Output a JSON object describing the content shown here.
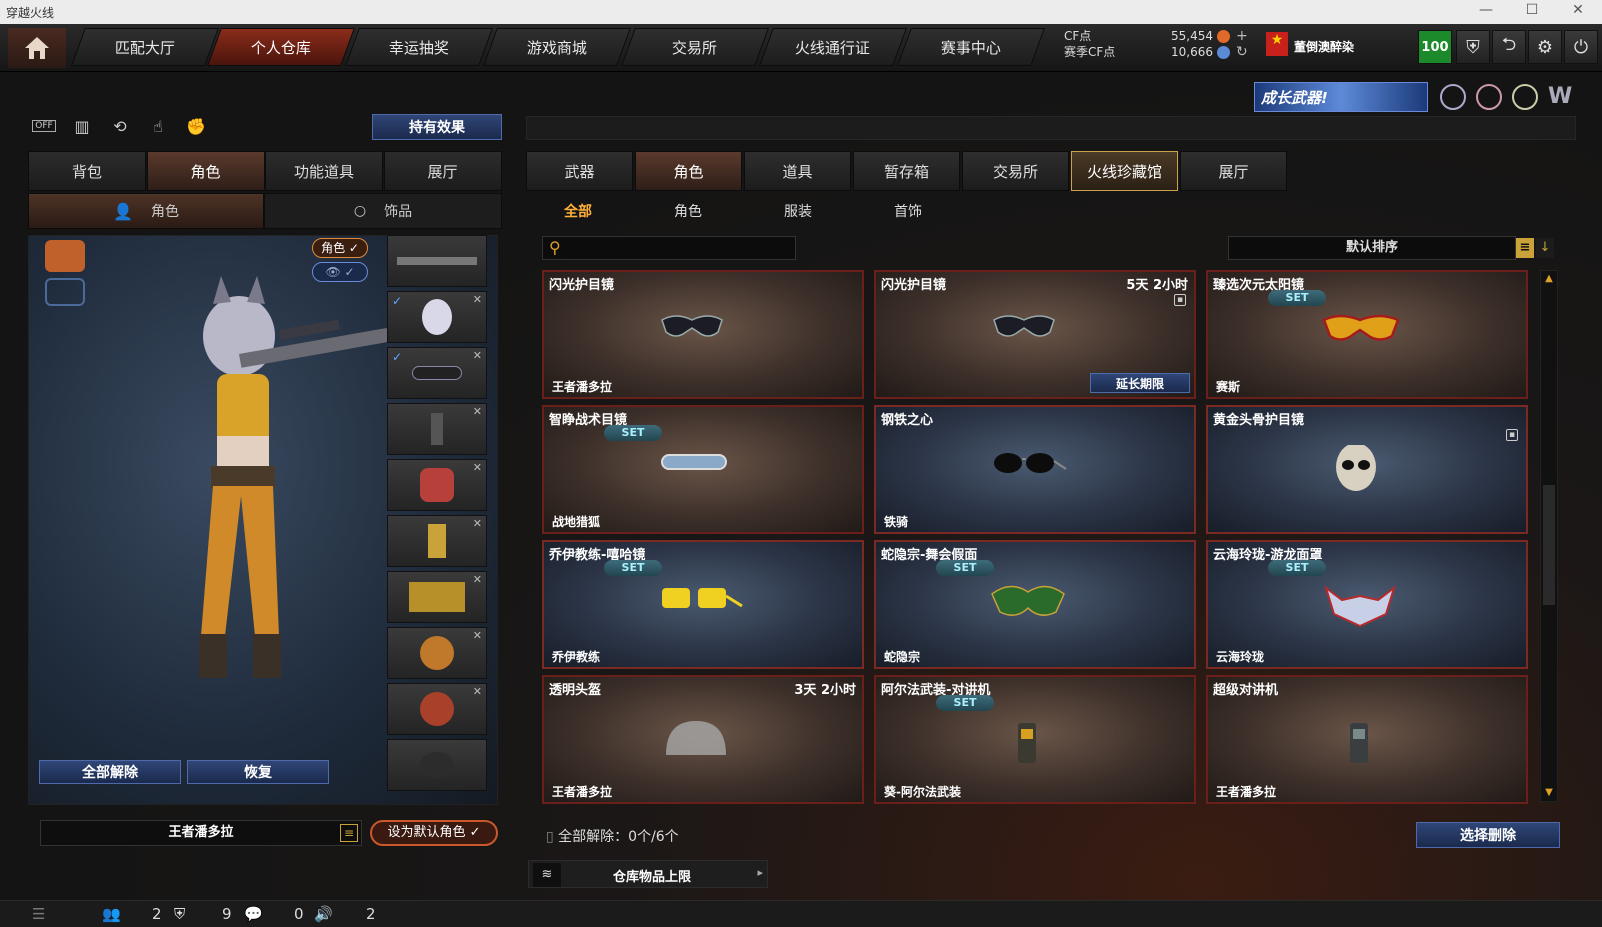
{
  "window": {
    "title": "穿越火线"
  },
  "topnav": {
    "tabs": [
      "匹配大厅",
      "个人仓库",
      "幸运抽奖",
      "游戏商城",
      "交易所",
      "火线通行证",
      "赛事中心"
    ],
    "active_index": 1,
    "cf_label": "CF点",
    "cf_value": "55,454",
    "match_cf_label": "赛季CF点",
    "match_cf_value": "10,666",
    "username": "董倒澳醉染",
    "level": "100"
  },
  "banner": {
    "text": "成长武器!"
  },
  "left": {
    "small_icons": [
      "toggle-off-icon",
      "chart-icon",
      "history-icon",
      "pointer-icon",
      "fist-icon"
    ],
    "off_label": "OFF",
    "effect_button": "持有效果",
    "tabs": [
      "背包",
      "角色",
      "功能道具",
      "展厅"
    ],
    "active_tab": 1,
    "subtabs": [
      "角色",
      "饰品"
    ],
    "badge_role": "角色 ✓",
    "btn_unequip_all": "全部解除",
    "btn_restore": "恢复",
    "character_name": "王者潘多拉",
    "btn_set_default": "设为默认角色 ✓"
  },
  "right": {
    "tabs": [
      "武器",
      "角色",
      "道具",
      "暂存箱",
      "交易所",
      "火线珍藏馆",
      "展厅"
    ],
    "active_tab": 1,
    "gold_tab": 5,
    "subtabs": [
      "全部",
      "角色",
      "服装",
      "首饰"
    ],
    "active_subtab": 0,
    "search_placeholder": "",
    "sort_label": "默认排序",
    "unequip_status": "全部解除：0个/6个",
    "btn_select_delete": "选择删除",
    "capacity_label": "仓库物品上限"
  },
  "cards": [
    {
      "name": "闪光护目镜",
      "time": "",
      "owner": "王者潘多拉",
      "set": false,
      "theme": "brown",
      "extend": ""
    },
    {
      "name": "闪光护目镜",
      "time": "5天 2小时",
      "owner": "",
      "set": false,
      "theme": "brown",
      "extend": "延长期限"
    },
    {
      "name": "臻选次元太阳镜",
      "time": "",
      "owner": "赛斯",
      "set": true,
      "theme": "brown",
      "extend": ""
    },
    {
      "name": "智睁战术目镜",
      "time": "",
      "owner": "战地猎狐",
      "set": true,
      "theme": "brown",
      "extend": ""
    },
    {
      "name": "钢铁之心",
      "time": "",
      "owner": "铁骑",
      "set": false,
      "theme": "blue",
      "extend": ""
    },
    {
      "name": "黄金头骨护目镜",
      "time": "",
      "owner": "",
      "set": false,
      "theme": "blue",
      "extend": ""
    },
    {
      "name": "乔伊教练-嘻哈镜",
      "time": "",
      "owner": "乔伊教练",
      "set": true,
      "theme": "blue",
      "extend": ""
    },
    {
      "name": "蛇隐宗-舞会假面",
      "time": "",
      "owner": "蛇隐宗",
      "set": true,
      "theme": "blue",
      "extend": ""
    },
    {
      "name": "云海玲珑-游龙面罩",
      "time": "",
      "owner": "云海玲珑",
      "set": true,
      "theme": "blue",
      "extend": ""
    },
    {
      "name": "透明头盔",
      "time": "3天 2小时",
      "owner": "王者潘多拉",
      "set": false,
      "theme": "brown",
      "extend": ""
    },
    {
      "name": "阿尔法武装-对讲机",
      "time": "",
      "owner": "葵-阿尔法武装",
      "set": true,
      "theme": "brown",
      "extend": ""
    },
    {
      "name": "超级对讲机",
      "time": "",
      "owner": "王者潘多拉",
      "set": false,
      "theme": "brown",
      "extend": ""
    }
  ],
  "set_label": "SET",
  "statusbar": {
    "friends": "2",
    "clan": "9",
    "chat": "0",
    "sound": "2"
  }
}
